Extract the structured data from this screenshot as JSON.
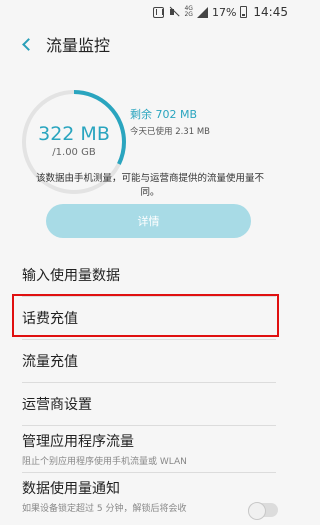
{
  "status_bar": {
    "network_top": "4G",
    "network_bottom": "2G",
    "battery": "17%",
    "time": "14:45"
  },
  "header": {
    "title": "流量监控"
  },
  "usage": {
    "used": "322 MB",
    "total": "/1.00 GB",
    "used_fraction": 0.322,
    "remaining": "剩余 702 MB",
    "today": "今天已使用 2.31 MB",
    "disclaimer": "该数据由手机测量，可能与运营商提供的流量使用量不同。",
    "details_button": "详情"
  },
  "menu": {
    "items": [
      {
        "label": "输入使用量数据"
      },
      {
        "label": "话费充值"
      },
      {
        "label": "流量充值"
      },
      {
        "label": "运营商设置"
      },
      {
        "label": "管理应用程序流量",
        "sub": "阻止个别应用程序使用手机流量或 WLAN"
      },
      {
        "label": "数据使用量通知",
        "sub": "如果设备锁定超过 5 分钟，解锁后将会收"
      }
    ]
  },
  "colors": {
    "accent": "#2aa5bf",
    "button": "#a8dbe6",
    "highlight": "#e01010"
  }
}
